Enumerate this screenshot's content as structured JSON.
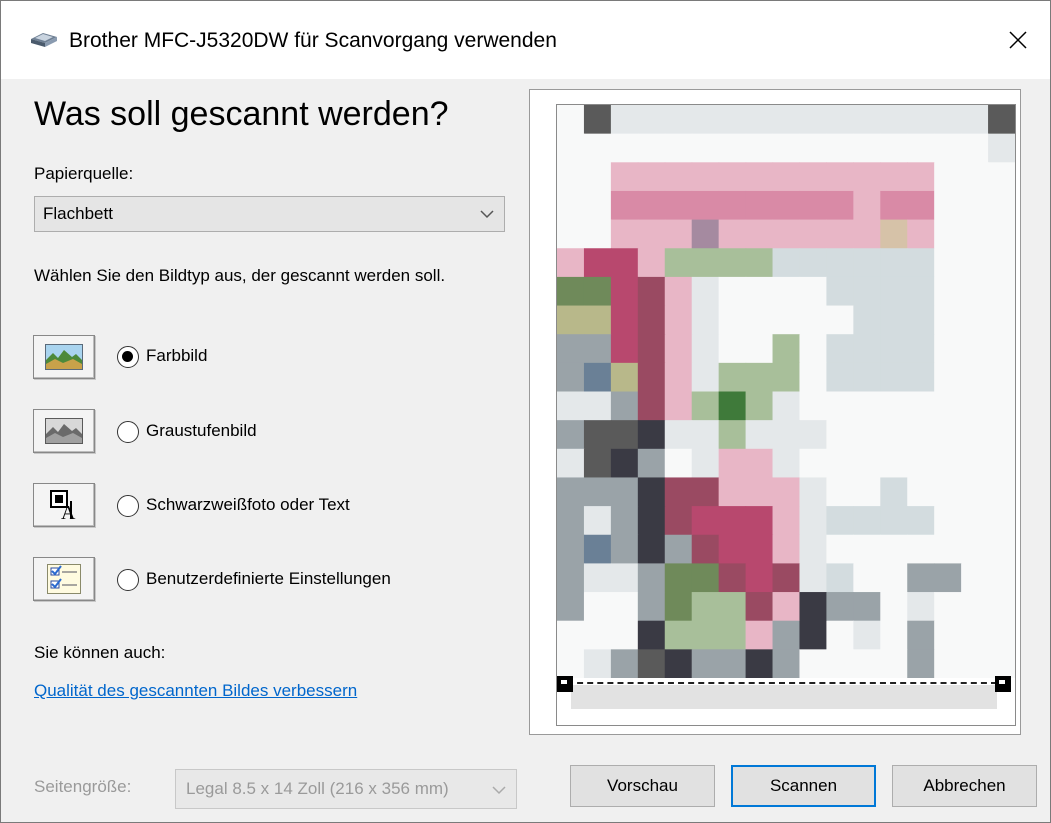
{
  "window": {
    "title": "Brother MFC-J5320DW für Scanvorgang verwenden"
  },
  "heading": "Was soll gescannt werden?",
  "paper_source": {
    "label": "Papierquelle:",
    "value": "Flachbett"
  },
  "image_type_prompt": "Wählen Sie den Bildtyp aus, der gescannt werden soll.",
  "image_types": [
    {
      "label": "Farbbild",
      "checked": true,
      "icon": "color-photo-icon"
    },
    {
      "label": "Graustufenbild",
      "checked": false,
      "icon": "grayscale-photo-icon"
    },
    {
      "label": "Schwarzweißfoto oder Text",
      "checked": false,
      "icon": "black-white-text-icon"
    },
    {
      "label": "Benutzerdefinierte Einstellungen",
      "checked": false,
      "icon": "custom-settings-icon"
    }
  ],
  "also": {
    "label": "Sie können auch:",
    "link": "Qualität des gescannten Bildes verbessern"
  },
  "page_size": {
    "label": "Seitengröße:",
    "value": "Legal 8.5 x 14 Zoll (216 x 356 mm)"
  },
  "buttons": {
    "preview": "Vorschau",
    "scan": "Scannen",
    "cancel": "Abbrechen"
  },
  "colors": {
    "link": "#0066cc",
    "primary_border": "#0078d7",
    "dialog_bg": "#f0f0f0"
  }
}
